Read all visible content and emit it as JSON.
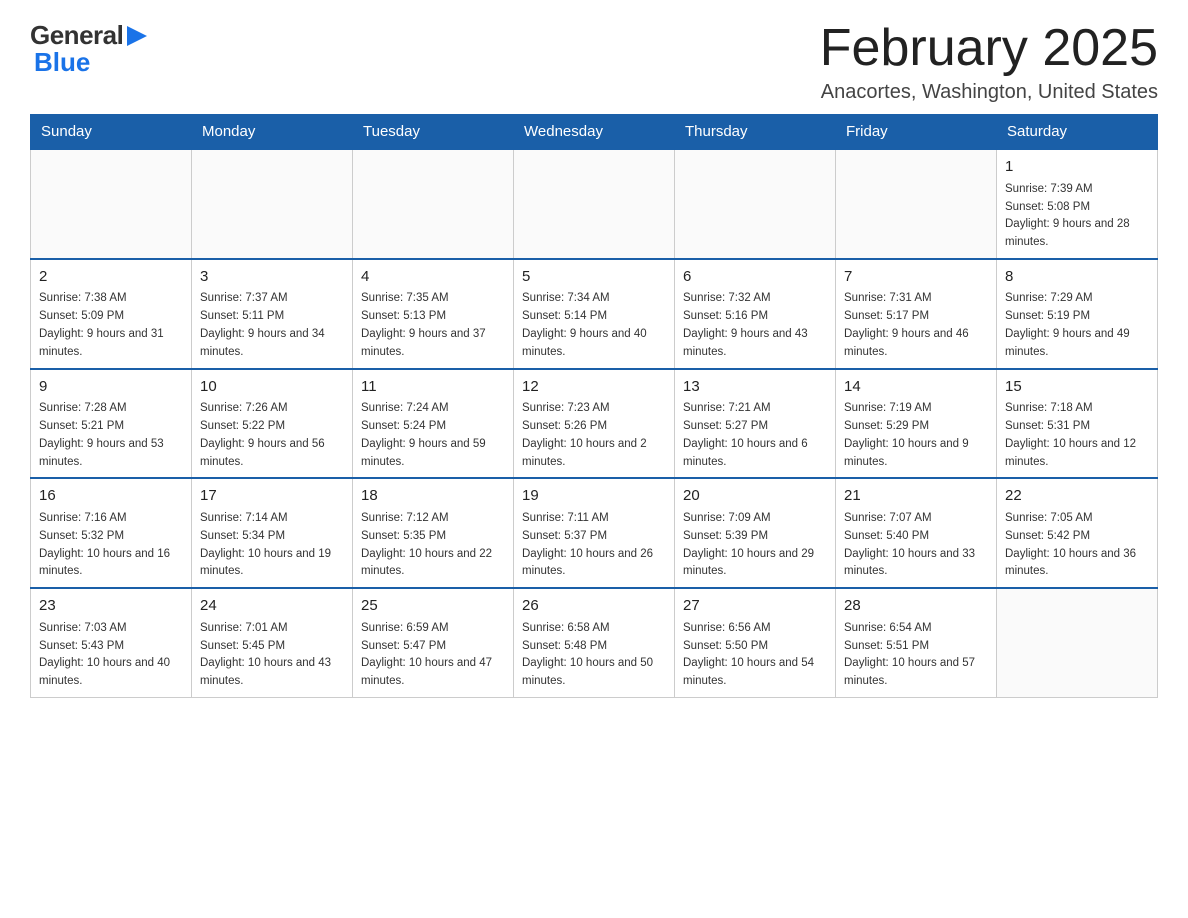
{
  "header": {
    "logo": {
      "general": "General",
      "blue": "Blue"
    },
    "title": "February 2025",
    "location": "Anacortes, Washington, United States"
  },
  "weekdays": [
    "Sunday",
    "Monday",
    "Tuesday",
    "Wednesday",
    "Thursday",
    "Friday",
    "Saturday"
  ],
  "weeks": [
    [
      {
        "day": "",
        "info": ""
      },
      {
        "day": "",
        "info": ""
      },
      {
        "day": "",
        "info": ""
      },
      {
        "day": "",
        "info": ""
      },
      {
        "day": "",
        "info": ""
      },
      {
        "day": "",
        "info": ""
      },
      {
        "day": "1",
        "info": "Sunrise: 7:39 AM\nSunset: 5:08 PM\nDaylight: 9 hours and 28 minutes."
      }
    ],
    [
      {
        "day": "2",
        "info": "Sunrise: 7:38 AM\nSunset: 5:09 PM\nDaylight: 9 hours and 31 minutes."
      },
      {
        "day": "3",
        "info": "Sunrise: 7:37 AM\nSunset: 5:11 PM\nDaylight: 9 hours and 34 minutes."
      },
      {
        "day": "4",
        "info": "Sunrise: 7:35 AM\nSunset: 5:13 PM\nDaylight: 9 hours and 37 minutes."
      },
      {
        "day": "5",
        "info": "Sunrise: 7:34 AM\nSunset: 5:14 PM\nDaylight: 9 hours and 40 minutes."
      },
      {
        "day": "6",
        "info": "Sunrise: 7:32 AM\nSunset: 5:16 PM\nDaylight: 9 hours and 43 minutes."
      },
      {
        "day": "7",
        "info": "Sunrise: 7:31 AM\nSunset: 5:17 PM\nDaylight: 9 hours and 46 minutes."
      },
      {
        "day": "8",
        "info": "Sunrise: 7:29 AM\nSunset: 5:19 PM\nDaylight: 9 hours and 49 minutes."
      }
    ],
    [
      {
        "day": "9",
        "info": "Sunrise: 7:28 AM\nSunset: 5:21 PM\nDaylight: 9 hours and 53 minutes."
      },
      {
        "day": "10",
        "info": "Sunrise: 7:26 AM\nSunset: 5:22 PM\nDaylight: 9 hours and 56 minutes."
      },
      {
        "day": "11",
        "info": "Sunrise: 7:24 AM\nSunset: 5:24 PM\nDaylight: 9 hours and 59 minutes."
      },
      {
        "day": "12",
        "info": "Sunrise: 7:23 AM\nSunset: 5:26 PM\nDaylight: 10 hours and 2 minutes."
      },
      {
        "day": "13",
        "info": "Sunrise: 7:21 AM\nSunset: 5:27 PM\nDaylight: 10 hours and 6 minutes."
      },
      {
        "day": "14",
        "info": "Sunrise: 7:19 AM\nSunset: 5:29 PM\nDaylight: 10 hours and 9 minutes."
      },
      {
        "day": "15",
        "info": "Sunrise: 7:18 AM\nSunset: 5:31 PM\nDaylight: 10 hours and 12 minutes."
      }
    ],
    [
      {
        "day": "16",
        "info": "Sunrise: 7:16 AM\nSunset: 5:32 PM\nDaylight: 10 hours and 16 minutes."
      },
      {
        "day": "17",
        "info": "Sunrise: 7:14 AM\nSunset: 5:34 PM\nDaylight: 10 hours and 19 minutes."
      },
      {
        "day": "18",
        "info": "Sunrise: 7:12 AM\nSunset: 5:35 PM\nDaylight: 10 hours and 22 minutes."
      },
      {
        "day": "19",
        "info": "Sunrise: 7:11 AM\nSunset: 5:37 PM\nDaylight: 10 hours and 26 minutes."
      },
      {
        "day": "20",
        "info": "Sunrise: 7:09 AM\nSunset: 5:39 PM\nDaylight: 10 hours and 29 minutes."
      },
      {
        "day": "21",
        "info": "Sunrise: 7:07 AM\nSunset: 5:40 PM\nDaylight: 10 hours and 33 minutes."
      },
      {
        "day": "22",
        "info": "Sunrise: 7:05 AM\nSunset: 5:42 PM\nDaylight: 10 hours and 36 minutes."
      }
    ],
    [
      {
        "day": "23",
        "info": "Sunrise: 7:03 AM\nSunset: 5:43 PM\nDaylight: 10 hours and 40 minutes."
      },
      {
        "day": "24",
        "info": "Sunrise: 7:01 AM\nSunset: 5:45 PM\nDaylight: 10 hours and 43 minutes."
      },
      {
        "day": "25",
        "info": "Sunrise: 6:59 AM\nSunset: 5:47 PM\nDaylight: 10 hours and 47 minutes."
      },
      {
        "day": "26",
        "info": "Sunrise: 6:58 AM\nSunset: 5:48 PM\nDaylight: 10 hours and 50 minutes."
      },
      {
        "day": "27",
        "info": "Sunrise: 6:56 AM\nSunset: 5:50 PM\nDaylight: 10 hours and 54 minutes."
      },
      {
        "day": "28",
        "info": "Sunrise: 6:54 AM\nSunset: 5:51 PM\nDaylight: 10 hours and 57 minutes."
      },
      {
        "day": "",
        "info": ""
      }
    ]
  ]
}
